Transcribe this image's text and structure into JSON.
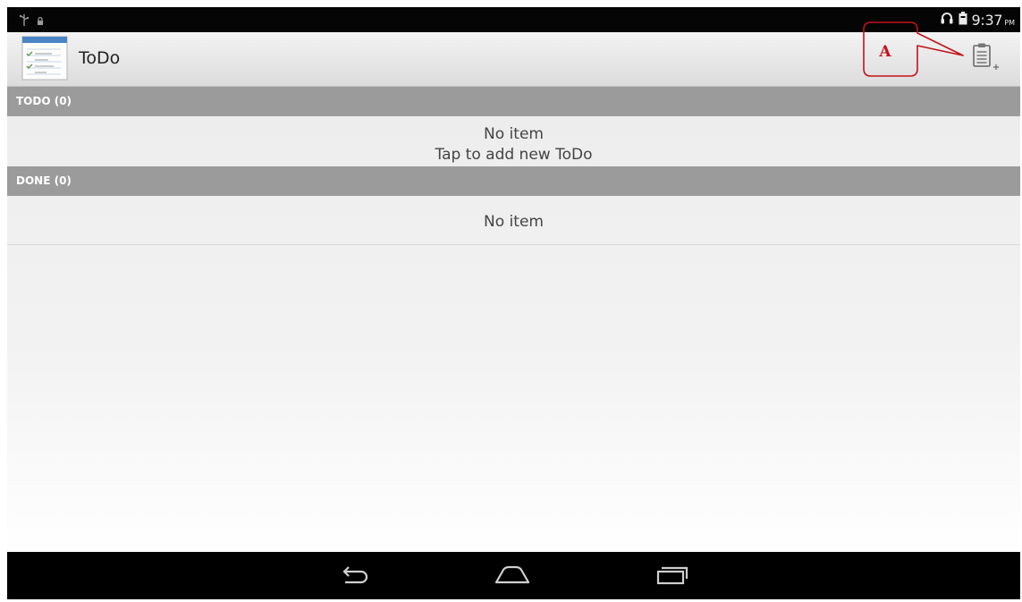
{
  "status_bar": {
    "time": "9:37",
    "ampm": "PM",
    "icons": [
      "usb-icon",
      "lock-icon",
      "headset-icon",
      "battery-icon"
    ]
  },
  "action_bar": {
    "title": "ToDo",
    "app_icon": "todo-app-icon",
    "add_button_icon": "clipboard-add-icon"
  },
  "annotation": {
    "label": "A",
    "color": "#c3121b"
  },
  "sections": {
    "todo": {
      "header": "TODO (0)",
      "empty_line1": "No item",
      "empty_line2": "Tap to add new ToDo"
    },
    "done": {
      "header": "DONE (0)",
      "empty_line1": "No item"
    }
  },
  "nav_bar": {
    "buttons": [
      "back-icon",
      "home-icon",
      "recents-icon"
    ]
  },
  "colors": {
    "section_header": "#9b9b9b",
    "status_bar": "#050505",
    "nav_bar": "#000000"
  }
}
